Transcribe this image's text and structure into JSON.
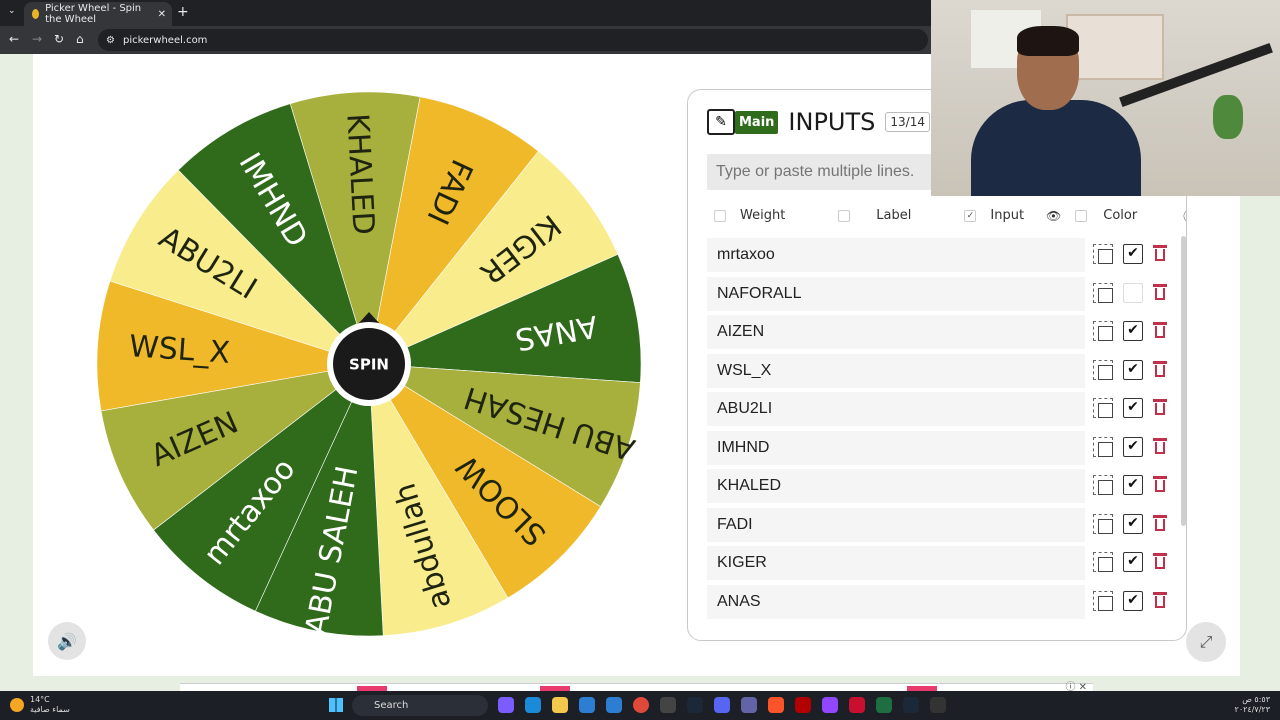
{
  "browser": {
    "tab_title": "Picker Wheel - Spin the Wheel",
    "url": "pickerwheel.com",
    "new_tab": "+",
    "close": "✕"
  },
  "wheel": {
    "spin_label": "SPIN",
    "colors": {
      "dark": "#2f6b1b",
      "olive": "#a8b03d",
      "gold": "#f0b92a",
      "yellow": "#f9ec8c"
    },
    "segments": [
      {
        "label": "KHALED",
        "color": "olive"
      },
      {
        "label": "FADI",
        "color": "gold"
      },
      {
        "label": "KIGER",
        "color": "yellow"
      },
      {
        "label": "ANAS",
        "color": "dark"
      },
      {
        "label": "ABU HESAH",
        "color": "olive"
      },
      {
        "label": "SLOOW",
        "color": "gold"
      },
      {
        "label": "abdullah",
        "color": "yellow"
      },
      {
        "label": "ABU SALEH",
        "color": "dark"
      },
      {
        "label": "mrtaxoo",
        "color": "dark"
      },
      {
        "label": "AIZEN",
        "color": "olive"
      },
      {
        "label": "WSL_X",
        "color": "gold"
      },
      {
        "label": "ABU2LI",
        "color": "yellow"
      },
      {
        "label": "IMHND",
        "color": "dark"
      }
    ]
  },
  "panel": {
    "main_badge": "Main",
    "title": "INPUTS",
    "count": "13/14",
    "paste_placeholder": "Type or paste multiple lines.",
    "options": {
      "weight": "Weight",
      "label": "Label",
      "input": "Input",
      "color": "Color"
    },
    "entries": [
      {
        "name": "mrtaxoo",
        "checked": true
      },
      {
        "name": "NAFORALL",
        "checked": false
      },
      {
        "name": "AIZEN",
        "checked": true
      },
      {
        "name": "WSL_X",
        "checked": true
      },
      {
        "name": "ABU2LI",
        "checked": true
      },
      {
        "name": "IMHND",
        "checked": true
      },
      {
        "name": "KHALED",
        "checked": true
      },
      {
        "name": "FADI",
        "checked": true
      },
      {
        "name": "KIGER",
        "checked": true
      },
      {
        "name": "ANAS",
        "checked": true
      }
    ]
  },
  "taskbar": {
    "temperature": "14°C",
    "weather_text": "سماء صافية",
    "search_label": "Search",
    "time": "٥:٥٣ ص",
    "date": "٢٠٢٤/٧/٢٣"
  }
}
